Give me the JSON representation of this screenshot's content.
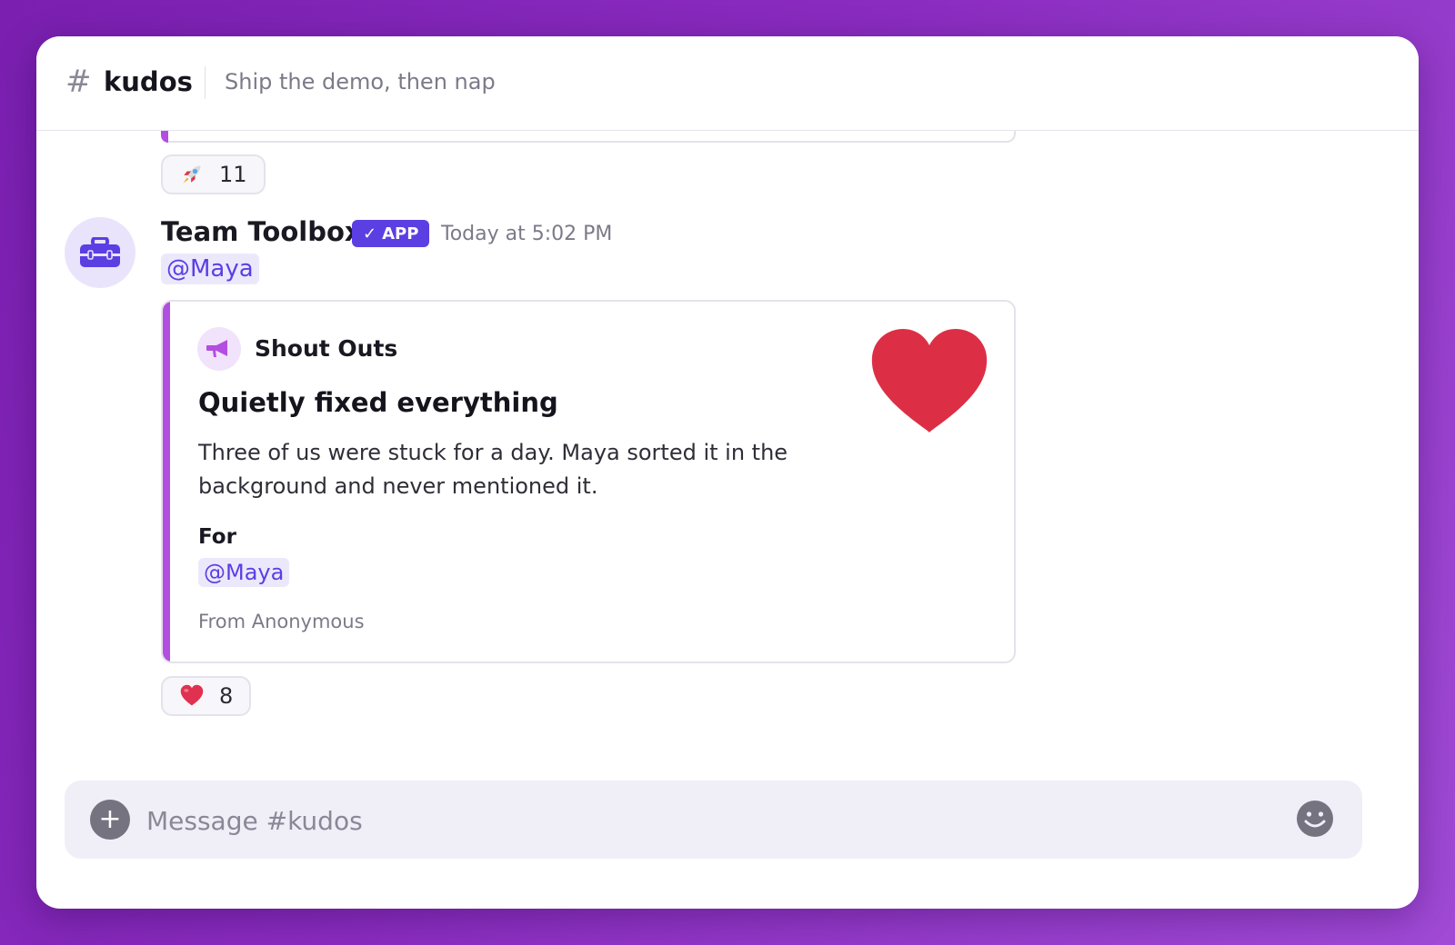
{
  "header": {
    "channel_name": "kudos",
    "topic": "Ship the demo, then nap"
  },
  "previous_message": {
    "reaction": {
      "emoji": "rocket",
      "count": "11"
    }
  },
  "message": {
    "sender": "Team Toolbox",
    "badge": "APP",
    "badge_check": "✓",
    "timestamp": "Today at 5:02 PM",
    "mention": "@Maya",
    "card": {
      "app_name": "Shout Outs",
      "title": "Quietly fixed everything",
      "body": "Three of us were stuck for a day. Maya sorted it in the background and never mentioned it.",
      "for_label": "For",
      "for_mention": "@Maya",
      "from": "From Anonymous",
      "accent_color": "#b24fe0",
      "image_icon": "heart-icon"
    },
    "reaction": {
      "emoji": "heart",
      "count": "8"
    }
  },
  "composer": {
    "placeholder": "Message #kudos",
    "plus_label": "+"
  },
  "colors": {
    "brand": "#5b3fe3",
    "heart": "#dc2f45"
  }
}
